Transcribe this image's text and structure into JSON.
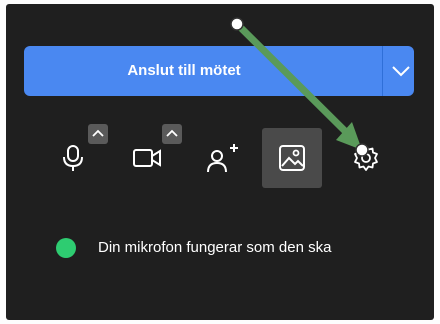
{
  "join": {
    "label": "Anslut till mötet"
  },
  "controls": [
    {
      "name": "microphone",
      "icon": "microphone-icon"
    },
    {
      "name": "camera",
      "icon": "video-camera-icon"
    },
    {
      "name": "add-participant",
      "icon": "add-person-icon"
    },
    {
      "name": "background",
      "icon": "image-icon"
    },
    {
      "name": "settings",
      "icon": "gear-icon"
    }
  ],
  "status": {
    "text": "Din mikrofon fungerar som den ska",
    "color": "#2ecc71"
  },
  "colors": {
    "accent": "#4a88f1",
    "panel": "#1f1f1f",
    "annotation_arrow": "#5a9a5a"
  }
}
